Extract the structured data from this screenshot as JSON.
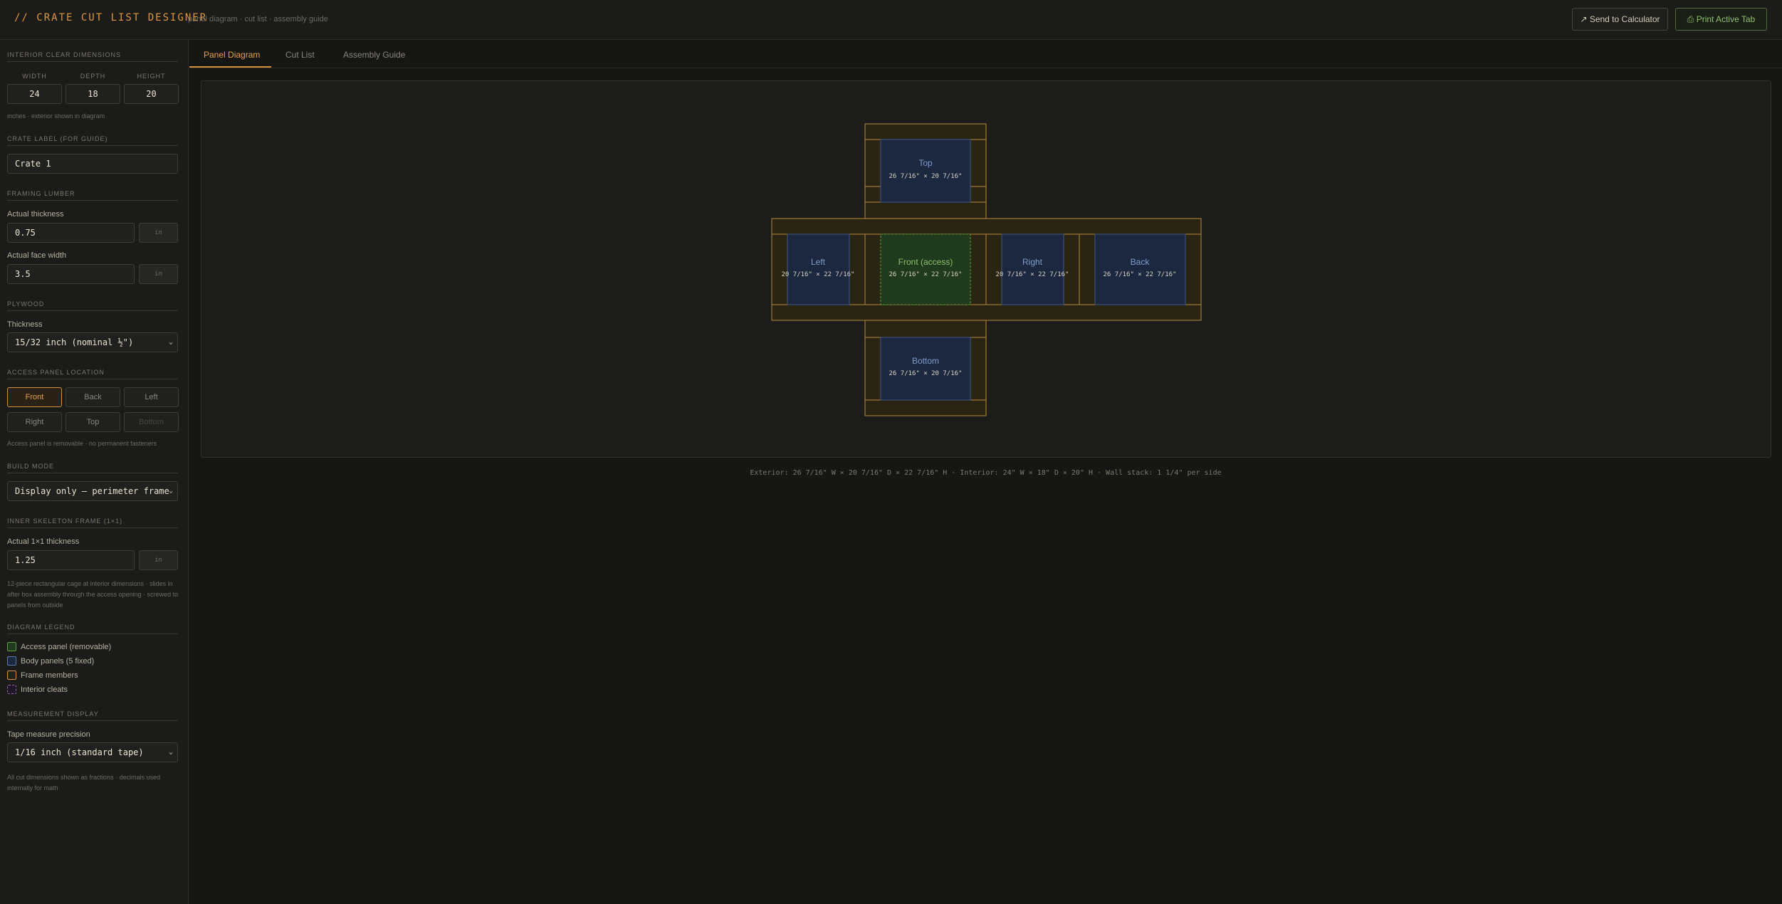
{
  "header": {
    "title": "// CRATE CUT LIST DESIGNER",
    "subtitle": "panel diagram · cut list · assembly guide",
    "send_button": "↗ Send to Calculator",
    "print_button": "⎙ Print Active Tab"
  },
  "sidebar": {
    "interior": {
      "title": "INTERIOR CLEAR DIMENSIONS",
      "width_label": "WIDTH",
      "width_value": "24",
      "depth_label": "DEPTH",
      "depth_value": "18",
      "height_label": "HEIGHT",
      "height_value": "20",
      "note": "inches · exterior shown in diagram"
    },
    "crate_label": {
      "title": "CRATE LABEL (FOR GUIDE)",
      "value": "Crate 1"
    },
    "framing": {
      "title": "FRAMING LUMBER",
      "thickness_label": "Actual thickness",
      "thickness_value": "0.75",
      "thickness_unit": "in",
      "face_label": "Actual face width",
      "face_value": "3.5",
      "face_unit": "in"
    },
    "plywood": {
      "title": "PLYWOOD",
      "thickness_label": "Thickness",
      "thickness_value": "15/32 inch (nominal ½\")"
    },
    "access": {
      "title": "ACCESS PANEL LOCATION",
      "options": [
        "Front",
        "Back",
        "Left",
        "Right",
        "Top",
        "Bottom"
      ],
      "selected": "Front",
      "disabled": "Bottom",
      "note": "Access panel is removable · no permanent fasteners"
    },
    "build_mode": {
      "title": "BUILD MODE",
      "value": "Display only — perimeter frame"
    },
    "skeleton": {
      "title": "INNER SKELETON FRAME (1×1)",
      "thickness_label": "Actual 1×1 thickness",
      "thickness_value": "1.25",
      "thickness_unit": "in",
      "note": "12-piece rectangular cage at interior dimensions · slides in after box assembly through the access opening · screwed to panels from outside"
    },
    "legend": {
      "title": "DIAGRAM LEGEND",
      "items": [
        {
          "label": "Access panel (removable)",
          "color": "#5fa042",
          "fill": "#1f3a1c"
        },
        {
          "label": "Body panels (5 fixed)",
          "color": "#5a7cb4",
          "fill": "#1c2840"
        },
        {
          "label": "Frame members",
          "color": "#d2903c",
          "fill": "#2a2012"
        },
        {
          "label": "Interior cleats",
          "color": "#9a62b8",
          "fill": "#201826"
        }
      ]
    },
    "measurement": {
      "title": "MEASUREMENT DISPLAY",
      "precision_label": "Tape measure precision",
      "precision_value": "1/16 inch (standard tape)",
      "note": "All cut dimensions shown as fractions · decimals used internally for math"
    }
  },
  "tabs": [
    {
      "label": "Panel Diagram",
      "active": true
    },
    {
      "label": "Cut List",
      "active": false
    },
    {
      "label": "Assembly Guide",
      "active": false
    }
  ],
  "diagram": {
    "panels": {
      "top": {
        "name": "Top",
        "dims": "26 7/16\" × 20 7/16\""
      },
      "left": {
        "name": "Left",
        "dims": "20 7/16\" × 22 7/16\""
      },
      "front": {
        "name": "Front (access)",
        "dims": "26 7/16\" × 22 7/16\""
      },
      "right": {
        "name": "Right",
        "dims": "20 7/16\" × 22 7/16\""
      },
      "back": {
        "name": "Back",
        "dims": "26 7/16\" × 22 7/16\""
      },
      "bottom": {
        "name": "Bottom",
        "dims": "26 7/16\" × 20 7/16\""
      }
    },
    "summary": "Exterior: 26 7/16\" W × 20 7/16\" D × 22 7/16\" H · Interior: 24\" W × 18\" D × 20\" H · Wall stack: 1 1/4\" per side"
  }
}
